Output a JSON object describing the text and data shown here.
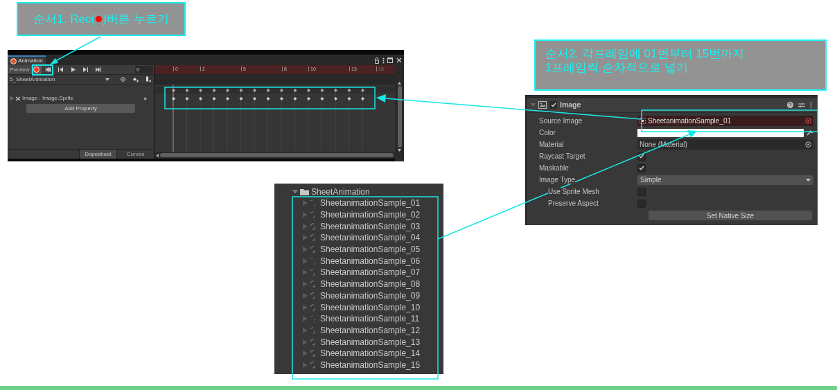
{
  "step1_callout": {
    "before": "순서1. Rec(",
    "after": ")버튼 누르기"
  },
  "step2_callout": {
    "lines": [
      "순서2. 각프레임에 01번부터 15번까지",
      "1프레임씩 순차적으로 넣기"
    ]
  },
  "animation_window": {
    "tab": "Animation",
    "preview": "Preview",
    "recording": true,
    "frame": "0",
    "clip": "5_SheetAnimation",
    "ruler_labels": [
      "0",
      "2",
      "5",
      "8",
      "10",
      "13",
      "15"
    ],
    "property": "Image : Image.Sprite",
    "add_property": "Add Property",
    "view_tabs": [
      {
        "label": "Dopesheet",
        "selected": true
      },
      {
        "label": "Curves",
        "selected": false
      }
    ]
  },
  "inspector": {
    "component": "Image",
    "enabled": true,
    "fields": [
      {
        "kind": "object",
        "label": "Source Image",
        "value": "SheetanimationSample_01",
        "animated": true
      },
      {
        "kind": "color",
        "label": "Color"
      },
      {
        "kind": "object",
        "label": "Material",
        "value": "None (Material)",
        "animated": false
      },
      {
        "kind": "checkbox",
        "label": "Raycast Target",
        "checked": true
      },
      {
        "kind": "checkbox",
        "label": "Maskable",
        "checked": true
      },
      {
        "kind": "dropdown",
        "label": "Image Type",
        "value": "Simple",
        "children": [
          {
            "kind": "checkbox",
            "label": "Use Sprite Mesh",
            "checked": false
          },
          {
            "kind": "checkbox",
            "label": "Preserve Aspect",
            "checked": false
          }
        ]
      }
    ],
    "button": "Set Native Size"
  },
  "project": {
    "folder": "SheetAnimation",
    "expanded": true,
    "items": [
      "SheetanimationSample_01",
      "SheetanimationSample_02",
      "SheetanimationSample_03",
      "SheetanimationSample_04",
      "SheetanimationSample_05",
      "SheetanimationSample_06",
      "SheetanimationSample_07",
      "SheetanimationSample_08",
      "SheetanimationSample_09",
      "SheetanimationSample_10",
      "SheetanimationSample_11",
      "SheetanimationSample_12",
      "SheetanimationSample_13",
      "SheetanimationSample_14",
      "SheetanimationSample_15"
    ]
  }
}
